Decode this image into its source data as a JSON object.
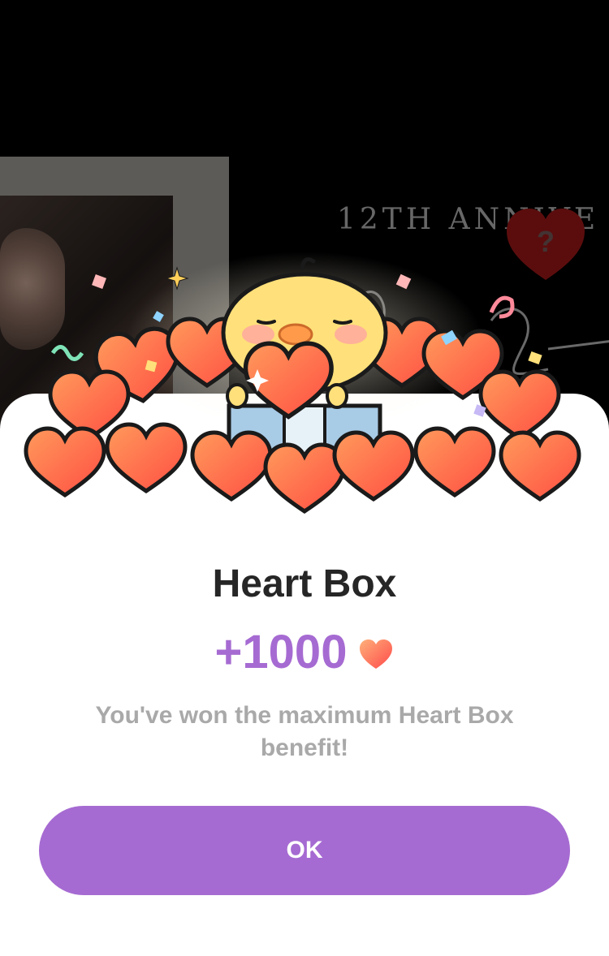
{
  "background": {
    "caption": "12TH ANNIVE"
  },
  "dialog": {
    "title": "Heart Box",
    "reward_amount": "+1000",
    "reward_icon": "heart-icon",
    "message": "You've won the maximum Heart Box benefit!",
    "ok_label": "OK"
  },
  "colors": {
    "accent": "#a66bd2",
    "title": "#262626",
    "message": "#a9a9a9",
    "heart": "#ff6a4a"
  }
}
